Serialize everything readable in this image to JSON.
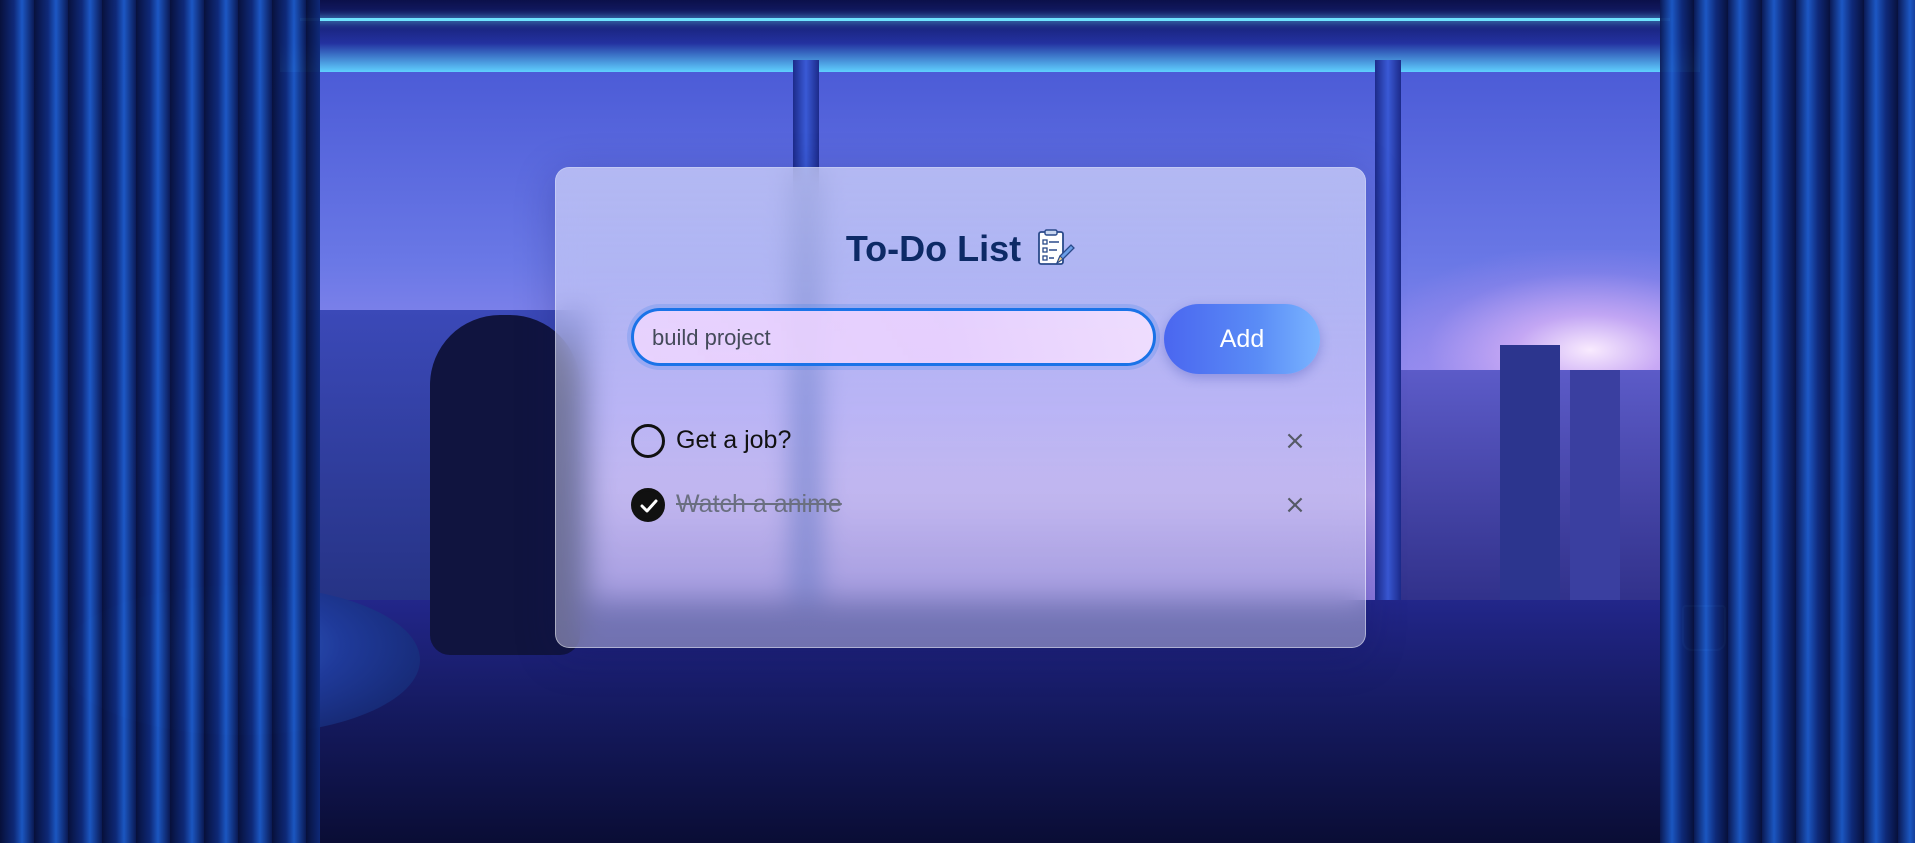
{
  "app": {
    "title": "To-Do List",
    "title_icon": "clipboard-pencil-icon"
  },
  "input": {
    "value": "build project",
    "placeholder": ""
  },
  "add_button": {
    "label": "Add"
  },
  "todos": [
    {
      "text": "Get a job?",
      "done": false,
      "remove_label": "×"
    },
    {
      "text": "Watch a anime",
      "done": true,
      "remove_label": "×"
    }
  ],
  "colors": {
    "title": "#0d2a66",
    "accent": "#1a73e8",
    "button_start": "#4a66f0",
    "button_end": "#7ab4ff"
  }
}
